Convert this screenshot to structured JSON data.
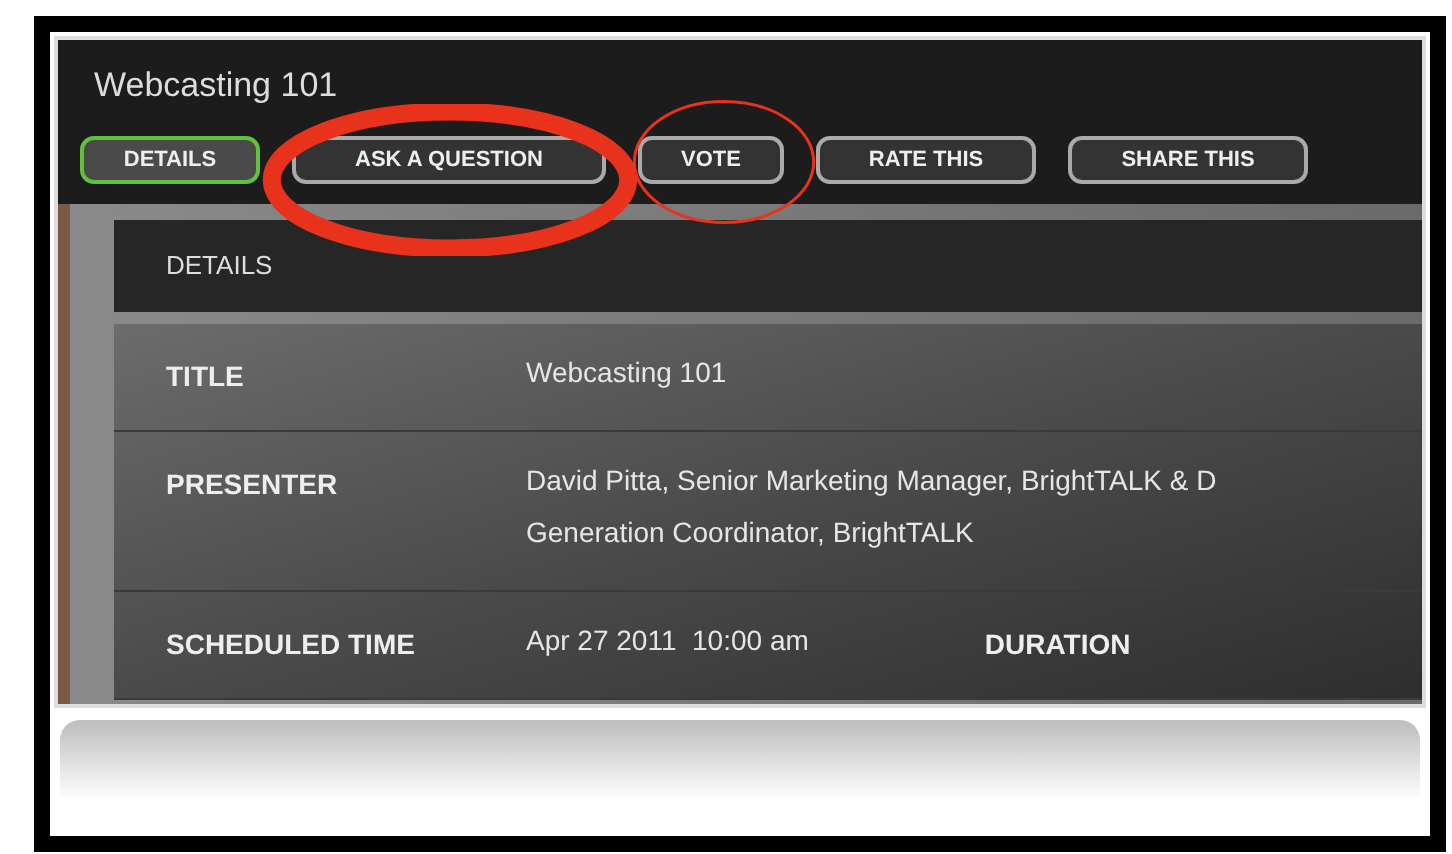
{
  "title": "Webcasting 101",
  "tabs": [
    {
      "label": "DETAILS",
      "selected": true
    },
    {
      "label": "ASK A QUESTION",
      "selected": false
    },
    {
      "label": "VOTE",
      "selected": false
    },
    {
      "label": "RATE THIS",
      "selected": false
    },
    {
      "label": "SHARE THIS",
      "selected": false
    }
  ],
  "details": {
    "heading": "DETAILS",
    "rows": [
      {
        "label": "TITLE",
        "value": [
          "Webcasting 101"
        ]
      },
      {
        "label": "PRESENTER",
        "value": [
          "David Pitta, Senior Marketing Manager, BrightTALK & D",
          "Generation Coordinator, BrightTALK"
        ]
      },
      {
        "label": "SCHEDULED TIME",
        "value": [
          "Apr 27 2011  10:00 am"
        ],
        "extra_label": "DURATION"
      }
    ]
  },
  "annotations": [
    {
      "kind": "thick"
    },
    {
      "kind": "thin"
    }
  ]
}
